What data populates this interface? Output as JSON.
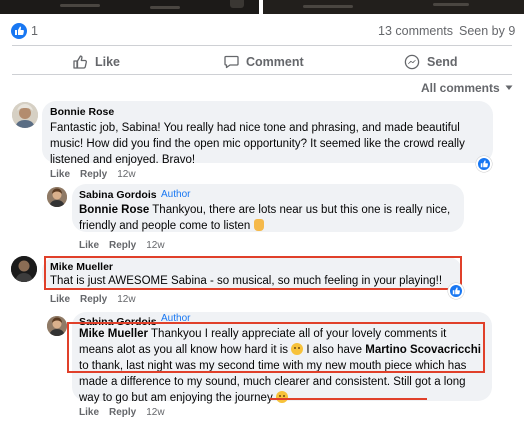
{
  "post": {
    "like_count": "1",
    "comments_count": "13 comments",
    "seen_by": "Seen by 9"
  },
  "actions": {
    "like": "Like",
    "comment": "Comment",
    "send": "Send"
  },
  "filter": {
    "label": "All comments"
  },
  "comments": [
    {
      "author": "Bonnie Rose",
      "text": "Fantastic job, Sabina! You really had nice tone and phrasing, and made beautiful music! How did you find the open mic opportunity? It seemed like the crowd really listened and enjoyed. Bravo!",
      "like": "Like",
      "reply": "Reply",
      "time": "12w"
    },
    {
      "author": "Sabina Gordois",
      "badge": "Author",
      "mention": "Bonnie Rose",
      "text": " Thankyou, there are lots near us but this one is really nice, friendly and people come to listen ",
      "like": "Like",
      "reply": "Reply",
      "time": "12w"
    },
    {
      "author": "Mike Mueller",
      "text": "That is just AWESOME Sabina - so musical, so much feeling in your playing!!",
      "like": "Like",
      "reply": "Reply",
      "time": "12w"
    },
    {
      "author": "Sabina Gordois",
      "badge": "Author",
      "mention": "Mike Mueller",
      "text_1": " Thankyou I really appreciate all of your lovely comments it means alot as you all know how hard it is ",
      "text_2": " I also have ",
      "mention_2": "Martino Scovacricchi",
      "text_3": " to thank, last night was my second time with my new mouth piece which has made a difference to my sound, much clearer and consistent. Still got a long way to go but am enjoying the journey ",
      "like": "Like",
      "reply": "Reply",
      "time": "12w"
    }
  ],
  "colors": {
    "accent": "#1877f2",
    "bubble": "#f0f2f5",
    "highlight": "#e0402a",
    "muted": "#65676b"
  }
}
